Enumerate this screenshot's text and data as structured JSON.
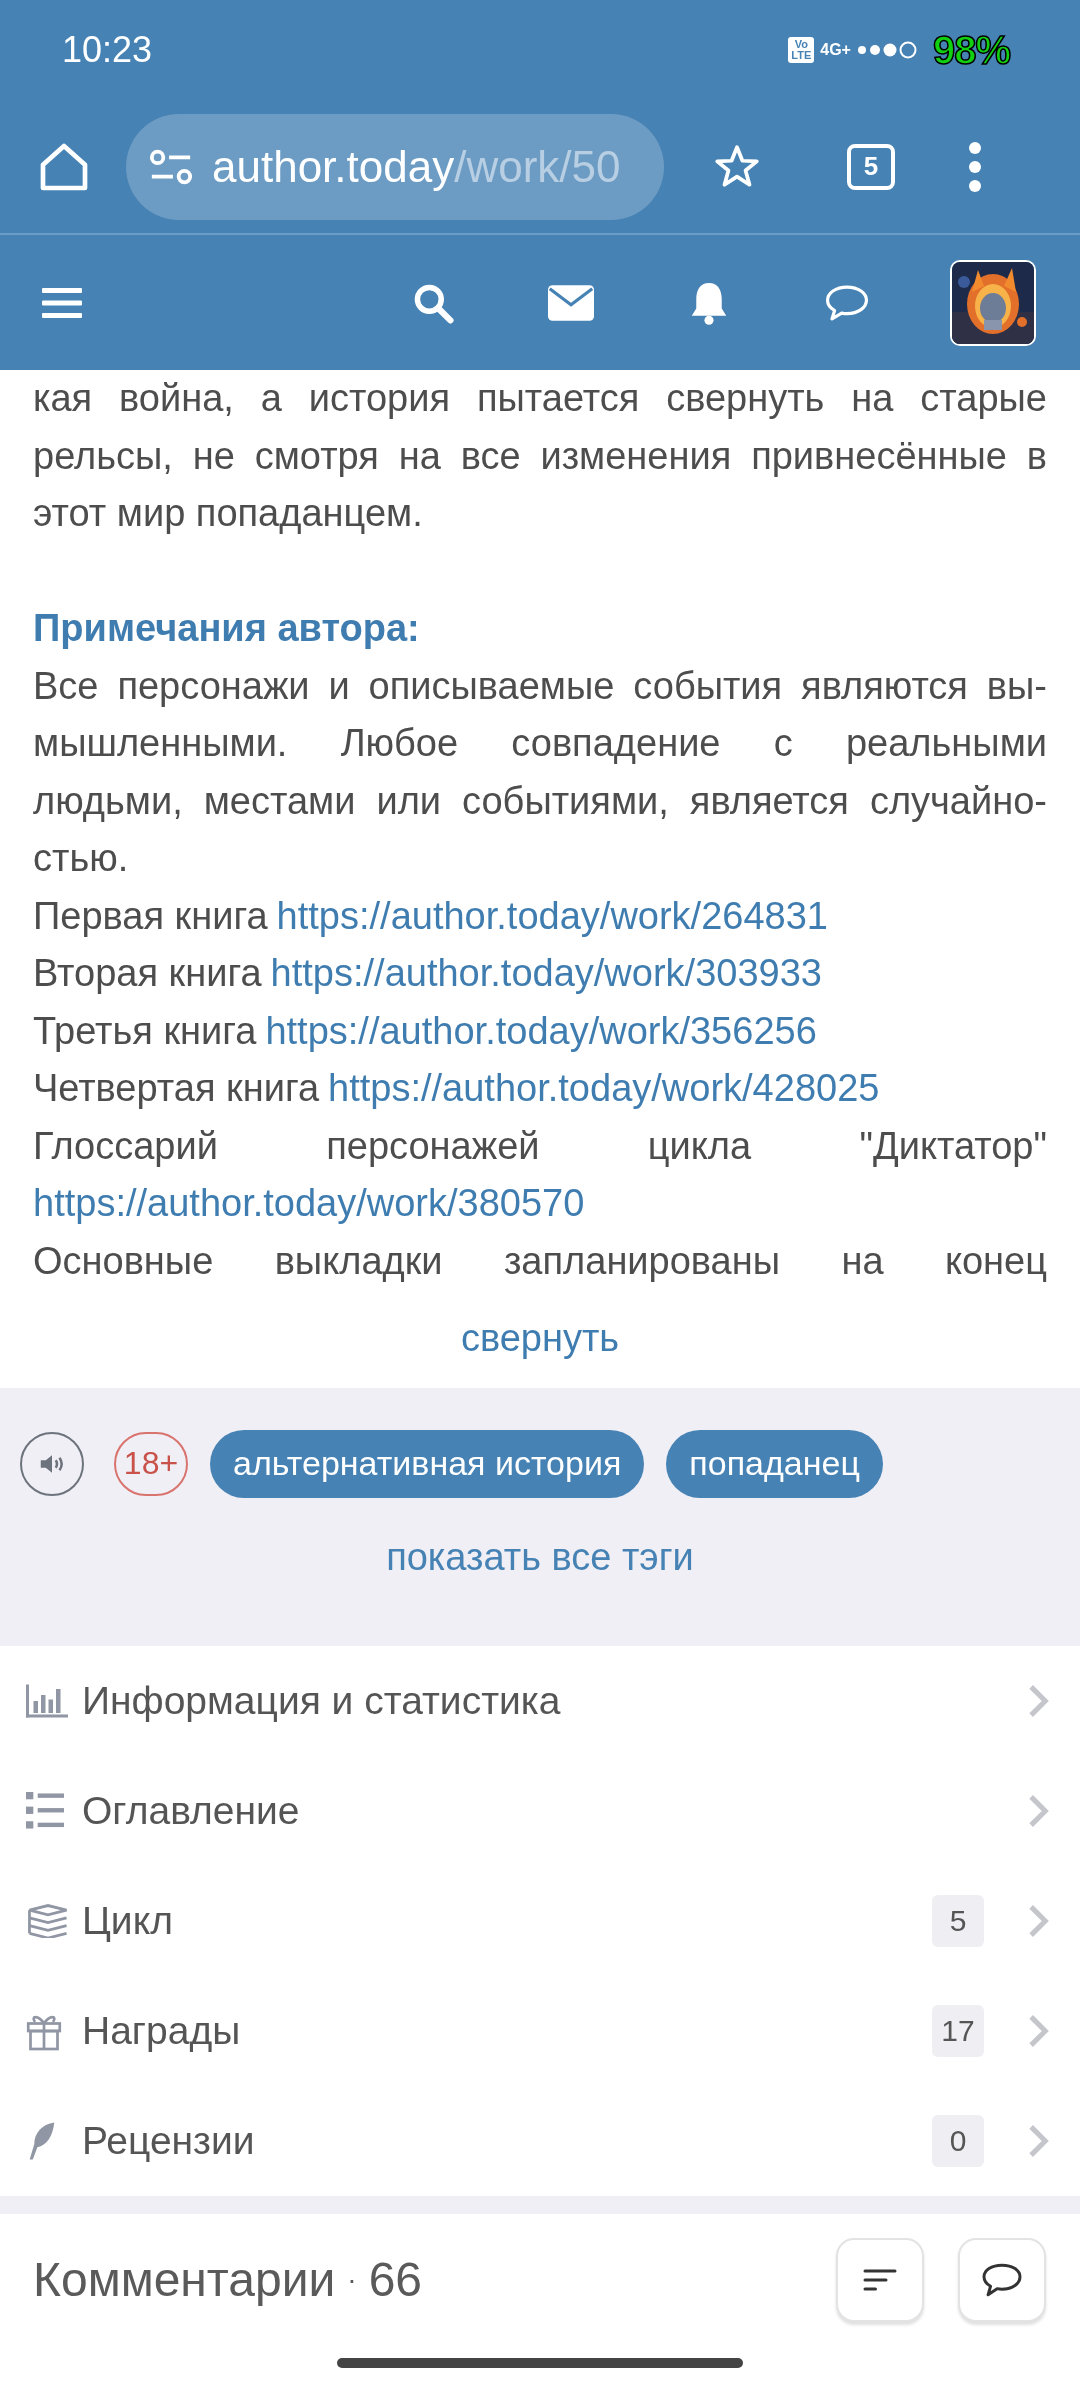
{
  "status_bar": {
    "time": "10:23",
    "volte": [
      "Vo",
      "LTE"
    ],
    "network": "4G+",
    "battery": "98%"
  },
  "browser": {
    "url_host": "author.today",
    "url_path": "/work/50",
    "tab_count": "5"
  },
  "site_nav": {
    "items": [
      {
        "kind": "search"
      },
      {
        "kind": "mail"
      },
      {
        "kind": "bell"
      },
      {
        "kind": "chat"
      }
    ]
  },
  "content": [
    {
      "kind": "paragraph",
      "cut": false,
      "lines": [
        "кая война, а история пытается свернуть на старые",
        "рельсы, не смотря на все изменения привнесённые в",
        "этот мир попаданцем."
      ]
    },
    {
      "kind": "gap"
    },
    {
      "kind": "heading",
      "text": "Примечания автора:"
    },
    {
      "kind": "paragraph",
      "lines": [
        "Все персонажи и описываемые события являются вы-",
        "мышленными. Любое совпадение с реальными",
        "людьми, местами или событиями, является случайно-",
        "стью."
      ]
    },
    {
      "kind": "link_line",
      "label": "Первая книга",
      "url": "https://author.today/work/264831"
    },
    {
      "kind": "link_line",
      "label": "Вторая книга",
      "url": "https://author.today/work/303933"
    },
    {
      "kind": "link_line",
      "label": "Третья книга",
      "url": "https://author.today/work/356256"
    },
    {
      "kind": "link_line",
      "label": "Четвертая книга",
      "url": "https://author.today/work/428025"
    },
    {
      "kind": "link_below",
      "label": "Глоссарий персонажей цикла \"Диктатор\"",
      "url": "https://author.today/work/380570"
    },
    {
      "kind": "paragraph",
      "cut": true,
      "lines": [
        "Основные выкладки запланированы на конец"
      ]
    }
  ],
  "collapse_link": "свернуть",
  "tags": [
    {
      "kind": "audio"
    },
    {
      "kind": "age",
      "text": "18+"
    },
    {
      "kind": "tag",
      "text": "альтернативная история"
    },
    {
      "kind": "tag",
      "text": "попаданец"
    }
  ],
  "show_all_tags": "показать все тэги",
  "menu": [
    {
      "kind": "stats",
      "label": "Информация и статистика"
    },
    {
      "kind": "toc",
      "label": "Оглавление"
    },
    {
      "kind": "series",
      "label": "Цикл",
      "count": "5"
    },
    {
      "kind": "awards",
      "label": "Награды",
      "count": "17"
    },
    {
      "kind": "reviews",
      "label": "Рецензии",
      "count": "0"
    }
  ],
  "comments": {
    "title": "Комментарии",
    "separator": "·",
    "count": "66"
  }
}
